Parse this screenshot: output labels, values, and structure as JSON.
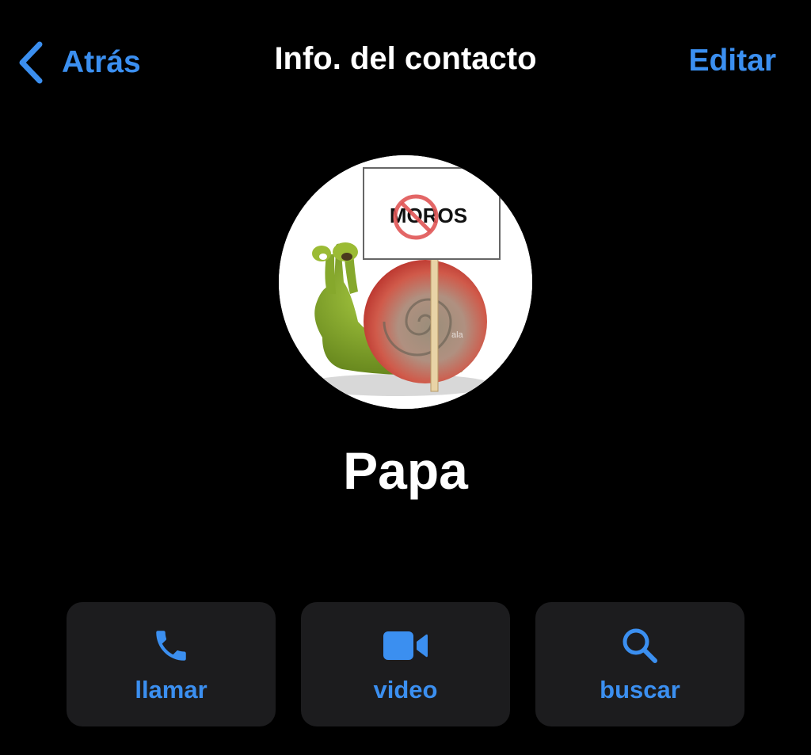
{
  "nav": {
    "back_label": "Atrás",
    "title": "Info. del contacto",
    "edit_label": "Editar"
  },
  "avatar": {
    "sign_text": "MOROS",
    "watermark": "ala"
  },
  "contact": {
    "name": "Papa"
  },
  "actions": [
    {
      "label": "llamar",
      "icon": "phone-icon"
    },
    {
      "label": "video",
      "icon": "video-camera-icon"
    },
    {
      "label": "buscar",
      "icon": "search-icon"
    }
  ],
  "colors": {
    "background": "#000000",
    "accent": "#3b8ff0",
    "button_background": "#1c1c1e",
    "text": "#ffffff"
  }
}
